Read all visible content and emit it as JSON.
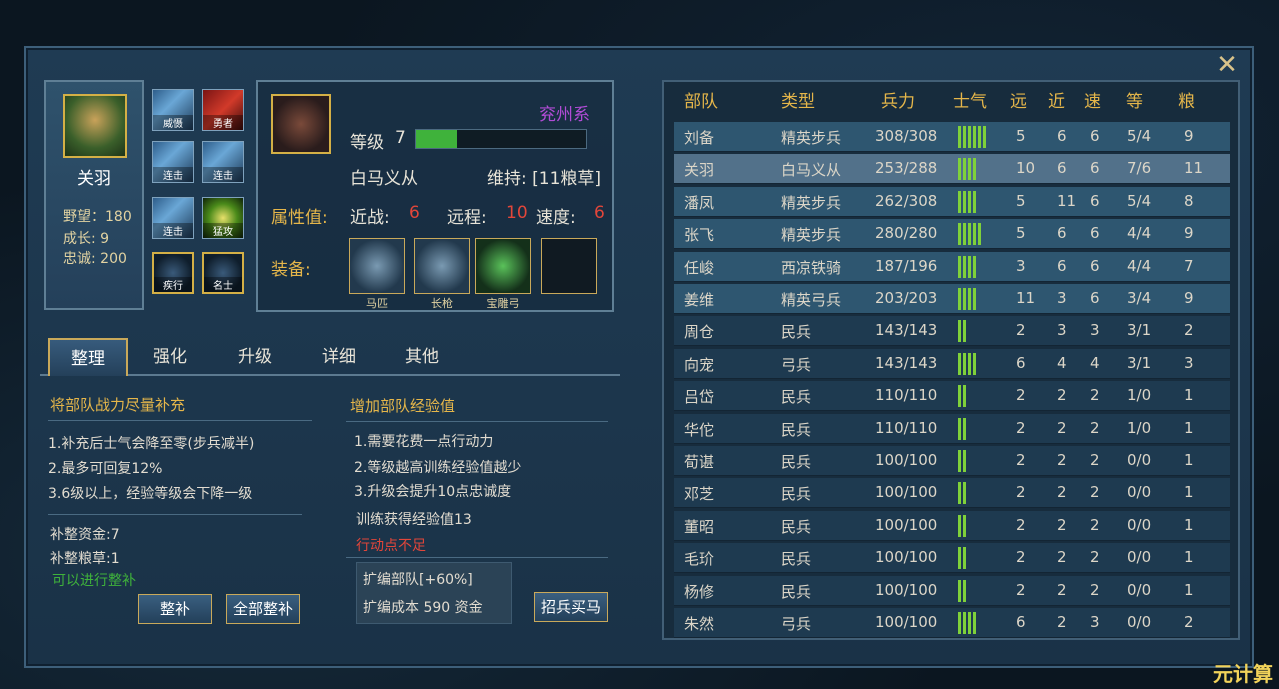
{
  "hero": {
    "name": "关羽",
    "ambition": "野望：180",
    "growth": "成长: 9",
    "loyalty": "忠诚: 200"
  },
  "skills": [
    "威慑",
    "勇者",
    "连击",
    "连击",
    "连击",
    "猛攻",
    "疾行",
    "名士"
  ],
  "unit": {
    "faction": "兖州系",
    "level_label": "等级",
    "level": "7",
    "level_progress": 0.24,
    "name": "白马义从",
    "upkeep": "维持: [11粮草]",
    "attr_label": "属性值:",
    "melee_label": "近战:",
    "melee": "6",
    "ranged_label": "远程:",
    "ranged": "10",
    "speed_label": "速度:",
    "speed": "6",
    "equip_label": "装备:",
    "equips": [
      "马匹",
      "长枪",
      "宝雕弓",
      ""
    ]
  },
  "tabs": [
    "整理",
    "强化",
    "升级",
    "详细",
    "其他"
  ],
  "left": {
    "title": "将部队战力尽量补充",
    "lines": [
      "1.补充后士气会降至零(步兵减半)",
      "2.最多可回复12%",
      "3.6级以上，经验等级会下降一级"
    ],
    "cost_gold": "补整资金:7",
    "cost_food": "补整粮草:1",
    "status": "可以进行整补",
    "btn1": "整补",
    "btn2": "全部整补"
  },
  "right": {
    "title": "增加部队经验值",
    "lines": [
      "1.需要花费一点行动力",
      "2.等级越高训练经验值越少",
      "3.升级会提升10点忠诚度"
    ],
    "gain": "训练获得经验值13",
    "warn": "行动点不足",
    "expand1": "扩编部队[+60%]",
    "expand2": "扩编成本 590 资金",
    "btn": "招兵买马"
  },
  "table": {
    "headers": [
      "部队",
      "类型",
      "兵力",
      "士气",
      "远",
      "近",
      "速",
      "等",
      "粮"
    ],
    "rows": [
      [
        "刘备",
        "精英步兵",
        "308/308",
        6,
        "5",
        "6",
        "6",
        "5/4",
        "9"
      ],
      [
        "关羽",
        "白马义从",
        "253/288",
        4,
        "10",
        "6",
        "6",
        "7/6",
        "11"
      ],
      [
        "潘凤",
        "精英步兵",
        "262/308",
        4,
        "5",
        "11",
        "6",
        "5/4",
        "8"
      ],
      [
        "张飞",
        "精英步兵",
        "280/280",
        5,
        "5",
        "6",
        "6",
        "4/4",
        "9"
      ],
      [
        "任峻",
        "西凉铁骑",
        "187/196",
        4,
        "3",
        "6",
        "6",
        "4/4",
        "7"
      ],
      [
        "姜维",
        "精英弓兵",
        "203/203",
        4,
        "11",
        "3",
        "6",
        "3/4",
        "9"
      ],
      [
        "周仓",
        "民兵",
        "143/143",
        2,
        "2",
        "3",
        "3",
        "3/1",
        "2"
      ],
      [
        "向宠",
        "弓兵",
        "143/143",
        4,
        "6",
        "4",
        "4",
        "3/1",
        "3"
      ],
      [
        "吕岱",
        "民兵",
        "110/110",
        2,
        "2",
        "2",
        "2",
        "1/0",
        "1"
      ],
      [
        "华佗",
        "民兵",
        "110/110",
        2,
        "2",
        "2",
        "2",
        "1/0",
        "1"
      ],
      [
        "荀谌",
        "民兵",
        "100/100",
        2,
        "2",
        "2",
        "2",
        "0/0",
        "1"
      ],
      [
        "邓芝",
        "民兵",
        "100/100",
        2,
        "2",
        "2",
        "2",
        "0/0",
        "1"
      ],
      [
        "董昭",
        "民兵",
        "100/100",
        2,
        "2",
        "2",
        "2",
        "0/0",
        "1"
      ],
      [
        "毛玠",
        "民兵",
        "100/100",
        2,
        "2",
        "2",
        "2",
        "0/0",
        "1"
      ],
      [
        "杨修",
        "民兵",
        "100/100",
        2,
        "2",
        "2",
        "2",
        "0/0",
        "1"
      ],
      [
        "朱然",
        "弓兵",
        "100/100",
        4,
        "6",
        "2",
        "3",
        "0/0",
        "2"
      ]
    ]
  },
  "watermark": "元计算"
}
